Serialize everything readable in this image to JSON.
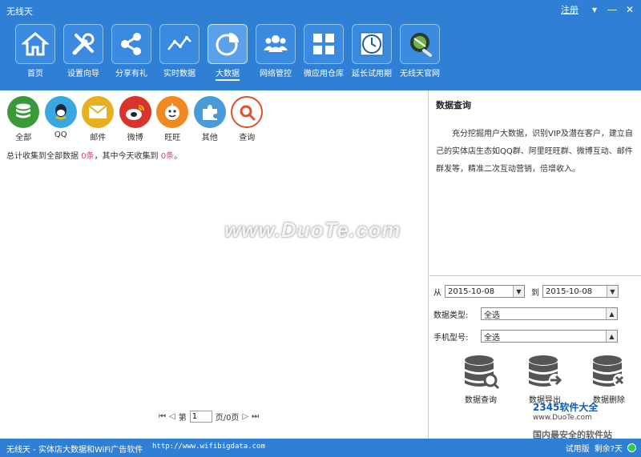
{
  "window": {
    "title": "无线天",
    "register": "注册"
  },
  "toolbar": [
    {
      "label": "首页",
      "icon": "home-icon"
    },
    {
      "label": "设置向导",
      "icon": "tools-icon"
    },
    {
      "label": "分享有礼",
      "icon": "share-icon"
    },
    {
      "label": "实时数据",
      "icon": "line-chart-icon"
    },
    {
      "label": "大数据",
      "icon": "pie-chart-icon",
      "active": true
    },
    {
      "label": "网络管控",
      "icon": "users-icon"
    },
    {
      "label": "微应用仓库",
      "icon": "grid-icon"
    },
    {
      "label": "延长试用期",
      "icon": "clock-icon"
    },
    {
      "label": "无线天官网",
      "icon": "globe-icon"
    }
  ],
  "categories": [
    {
      "label": "全部",
      "icon": "database-icon",
      "color": "#3a9a3a"
    },
    {
      "label": "QQ",
      "icon": "qq-icon",
      "color": "#3aa8e0"
    },
    {
      "label": "邮件",
      "icon": "mail-icon",
      "color": "#e8b020"
    },
    {
      "label": "微博",
      "icon": "weibo-icon",
      "color": "#d8342e"
    },
    {
      "label": "旺旺",
      "icon": "wangwang-icon",
      "color": "#f08a20"
    },
    {
      "label": "其他",
      "icon": "puzzle-icon",
      "color": "#4a9ad8"
    },
    {
      "label": "查询",
      "icon": "search-icon",
      "color": "#e0502a"
    }
  ],
  "summary": {
    "prefix": "总计收集到全部数据 ",
    "total": "0条",
    "mid": "，其中今天收集到 ",
    "today": "0条",
    "suffix": "。"
  },
  "pager": {
    "first": "⏮",
    "prev": "◁",
    "page_prefix": "第",
    "page_value": "1",
    "page_suffix": "页/0页",
    "next": "▷",
    "last": "⏭"
  },
  "info": {
    "title": "数据查询",
    "text": "充分挖掘用户大数据，识别VIP及潜在客户，建立自己的实体店生态如QQ群、阿里旺旺群、微博互动、邮件群发等，精准二次互动营销，倍增收入。"
  },
  "form": {
    "from_label": "从",
    "from_date": "2015-10-08",
    "to_label": "到",
    "to_date": "2015-10-08",
    "type_label": "数据类型:",
    "type_value": "全选",
    "phone_label": "手机型号:",
    "phone_value": "全选"
  },
  "actions": [
    {
      "label": "数据查询",
      "icon": "db-search-icon"
    },
    {
      "label": "数据导出",
      "icon": "db-export-icon"
    },
    {
      "label": "数据删除",
      "icon": "db-delete-icon"
    }
  ],
  "watermark": "www.DuoTe.com",
  "site_mark": {
    "brand": "2345软件大全",
    "url": "www.DuoTe.com",
    "slogan": "国内最安全的软件站"
  },
  "status": {
    "left": "无线天 - 实体店大数据和WiFi广告软件",
    "url": "http://www.wifibigdata.com",
    "trial": "试用版",
    "remaining": "剩余?天"
  }
}
